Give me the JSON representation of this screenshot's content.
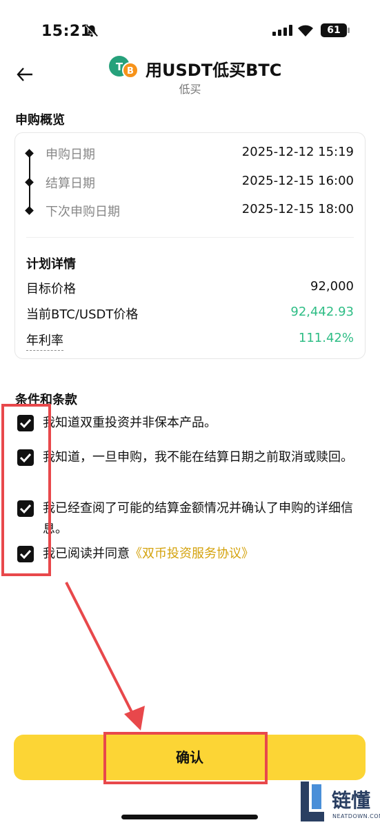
{
  "status_bar": {
    "time": "15:21",
    "battery": "61"
  },
  "header": {
    "title": "用USDT低买BTC",
    "subtitle": "低买"
  },
  "overview": {
    "title": "申购概览",
    "timeline": [
      {
        "label": "申购日期",
        "value": "2025-12-12 15:19"
      },
      {
        "label": "结算日期",
        "value": "2025-12-15 16:00"
      },
      {
        "label": "下次申购日期",
        "value": "2025-12-15 18:00"
      }
    ],
    "plan": {
      "title": "计划详情",
      "rows": [
        {
          "label": "目标价格",
          "value": "92,000",
          "color": "#111111"
        },
        {
          "label": "当前BTC/USDT价格",
          "value": "92,442.93",
          "color": "#2ebd85"
        },
        {
          "label": "年利率",
          "value": "111.42%",
          "color": "#2ebd85"
        }
      ]
    }
  },
  "terms": {
    "title": "条件和条款",
    "items": [
      {
        "text": "我知道双重投资并非保本产品。",
        "checked": true
      },
      {
        "text": "我知道，一旦申购，我不能在结算日期之前取消或赎回。",
        "checked": true
      },
      {
        "text": "我已经查阅了可能的结算金额情况并确认了申购的详细信息。",
        "checked": true
      },
      {
        "text": "我已阅读并同意",
        "link": "《双币投资服务协议》",
        "checked": true
      }
    ]
  },
  "confirm_label": "确认",
  "watermark": {
    "text": "链懂",
    "sub": "NEATDOWN.COM"
  },
  "colors": {
    "accent": "#fcd535",
    "positive": "#2ebd85",
    "link": "#d4a20c",
    "annotation": "#e8484b"
  }
}
